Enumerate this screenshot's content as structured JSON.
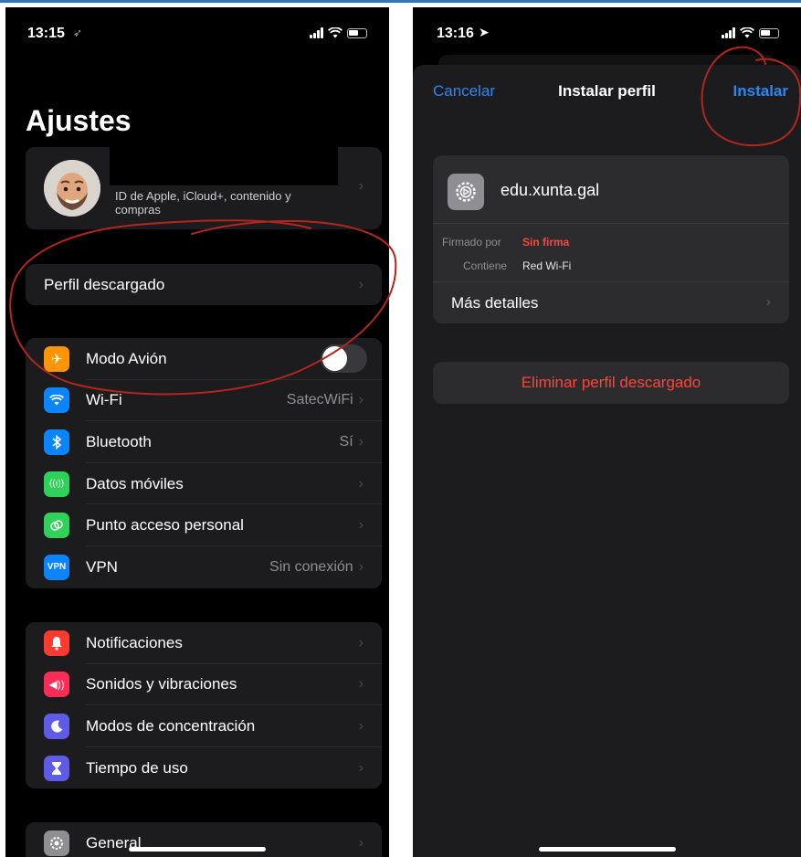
{
  "left": {
    "time": "13:15",
    "title": "Ajustes",
    "apple_id_subtitle": "ID de Apple, iCloud+, contenido y compras",
    "downloaded_profile": "Perfil descargado",
    "connectivity": [
      {
        "label": "Modo Avión",
        "value": "",
        "icon": "airplane-icon",
        "color": "#ff9500",
        "toggle": false
      },
      {
        "label": "Wi-Fi",
        "value": "SatecWiFi",
        "icon": "wifi-icon",
        "color": "#0a84ff"
      },
      {
        "label": "Bluetooth",
        "value": "Sí",
        "icon": "bluetooth-icon",
        "color": "#0a84ff"
      },
      {
        "label": "Datos móviles",
        "value": "",
        "icon": "antenna-icon",
        "color": "#30d158"
      },
      {
        "label": "Punto acceso personal",
        "value": "",
        "icon": "link-icon",
        "color": "#30d158"
      },
      {
        "label": "VPN",
        "value": "Sin conexión",
        "icon": "vpn-icon",
        "icon_text": "VPN",
        "color": "#0a84ff"
      }
    ],
    "notifications": [
      {
        "label": "Notificaciones",
        "icon": "bell-icon",
        "color": "#ff3b30"
      },
      {
        "label": "Sonidos y vibraciones",
        "icon": "speaker-icon",
        "color": "#ff2d55"
      },
      {
        "label": "Modos de concentración",
        "icon": "moon-icon",
        "color": "#5e5ce6"
      },
      {
        "label": "Tiempo de uso",
        "icon": "hourglass-icon",
        "color": "#5e5ce6"
      }
    ],
    "general": {
      "label": "General",
      "icon": "gear-icon",
      "color": "#8e8e93"
    }
  },
  "right": {
    "time": "13:16",
    "cancel": "Cancelar",
    "title": "Instalar perfil",
    "install": "Instalar",
    "profile_name": "edu.xunta.gal",
    "signed_by_label": "Firmado por",
    "signed_by_value": "Sin firma",
    "contains_label": "Contiene",
    "contains_value": "Red Wi-Fi",
    "more_details": "Más detalles",
    "remove": "Eliminar perfil descargado"
  },
  "colors": {
    "accent_blue": "#2f86f2",
    "destructive_red": "#ff453a",
    "annotation_red": "#b3261e"
  }
}
